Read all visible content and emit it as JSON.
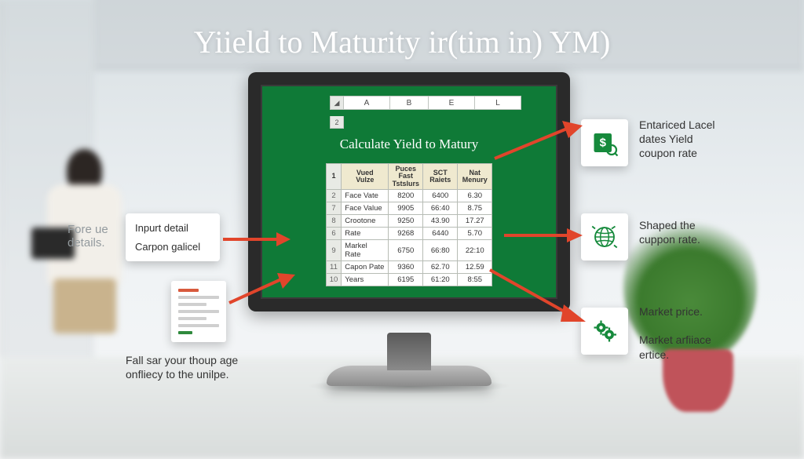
{
  "title": "Yiield to Maturity ir(tim in)  YM)",
  "monitor": {
    "corner_glyph": "◢",
    "col_letters": [
      "A",
      "B",
      "E",
      "L"
    ],
    "subrow_number": "2",
    "heading": "Calculate Yield to Matury",
    "table": {
      "headers": {
        "rownum": "1",
        "c1a": "Vued",
        "c1b": "Vulze",
        "c2a": "Puces",
        "c2b": "Fast Tstslurs",
        "c3a": "SCT",
        "c3b": "Raiets",
        "c4a": "Nat",
        "c4b": "Menury"
      },
      "rows": [
        {
          "n": "2",
          "label": "Face Vate",
          "a": "8200",
          "b": "6400",
          "c": "6.30",
          "hl": false
        },
        {
          "n": "7",
          "label": "Face Value",
          "a": "9905",
          "b": "66:40",
          "c": "8.75",
          "hl": false
        },
        {
          "n": "8",
          "label": "Crootone",
          "a": "9250",
          "b": "43.90",
          "c": "17.27",
          "hl": true
        },
        {
          "n": "6",
          "label": "Rate",
          "a": "9268",
          "b": "6440",
          "c": "5.70",
          "hl": false
        },
        {
          "n": "9",
          "label": "Markel Rate",
          "a": "6750",
          "b": "66:80",
          "c": "22:10",
          "hl": true
        },
        {
          "n": "11",
          "label": "Capon Pate",
          "a": "9360",
          "b": "62.70",
          "c": "12.59",
          "hl": false
        },
        {
          "n": "10",
          "label": "Years",
          "a": "6195",
          "b": "61:20",
          "c": "8:55",
          "hl": false
        }
      ]
    }
  },
  "left": {
    "ghost_line1": "Fore ue",
    "ghost_line2": "details.",
    "card_line1": "Inpurt detail",
    "card_line2": "Carpon galicel",
    "bottom_line1": "Fall sar your thoup age",
    "bottom_line2": "onfliecy to the unilpe."
  },
  "right": {
    "r1_line1": "Entariced Lacel",
    "r1_line2": "dates Yield",
    "r1_line3": "coupon rate",
    "r2_line1": "Shaped the",
    "r2_line2": "cuppon rate.",
    "r3_line1": "Market price.",
    "r3_line2": "Market arfiiace",
    "r3_line3": "ertice."
  },
  "colors": {
    "green": "#0f7a37",
    "arrow": "#e1452b",
    "icon": "#168a3c"
  }
}
